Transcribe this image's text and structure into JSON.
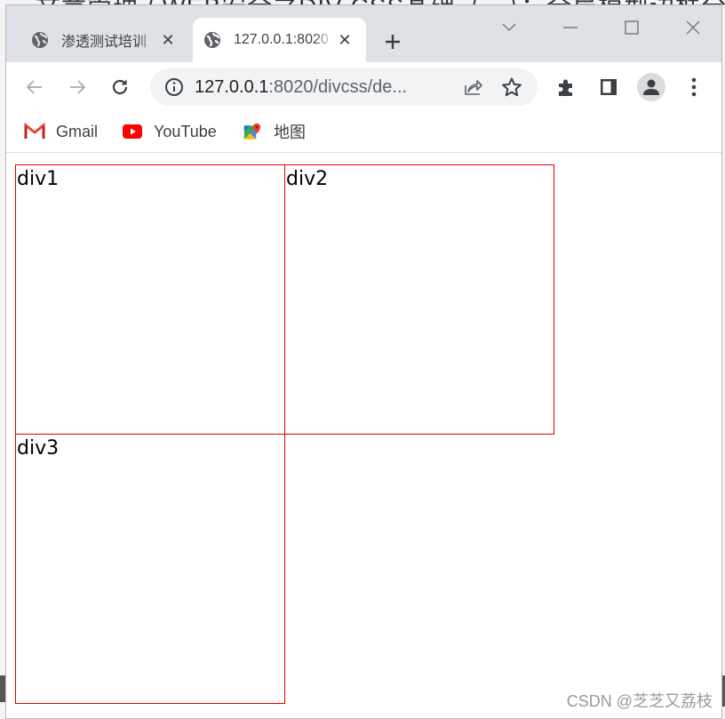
{
  "background": {
    "partial_title": "文章管理 / WEB安全之DIV CSS基础（三）：全局模型边框分类"
  },
  "browser": {
    "tabs": [
      {
        "title": "渗透测试培训",
        "icon": "globe-icon",
        "active": false
      },
      {
        "title": "127.0.0.1:8020",
        "icon": "globe-icon",
        "active": true
      }
    ],
    "new_tab_label": "+",
    "window_controls": [
      "tab-search",
      "minimize",
      "maximize",
      "close"
    ],
    "address_bar": {
      "host": "127.0.0.1",
      "rest": ":8020/divcss/de..."
    },
    "bookmarks": [
      {
        "label": "Gmail",
        "icon": "gmail-icon"
      },
      {
        "label": "YouTube",
        "icon": "youtube-icon"
      },
      {
        "label": "地图",
        "icon": "maps-icon"
      }
    ]
  },
  "page": {
    "boxes": [
      {
        "label": "div1"
      },
      {
        "label": "div2"
      },
      {
        "label": "div3"
      }
    ],
    "border_color": "#e00000"
  },
  "watermark": "CSDN @芝芝又荔枝"
}
